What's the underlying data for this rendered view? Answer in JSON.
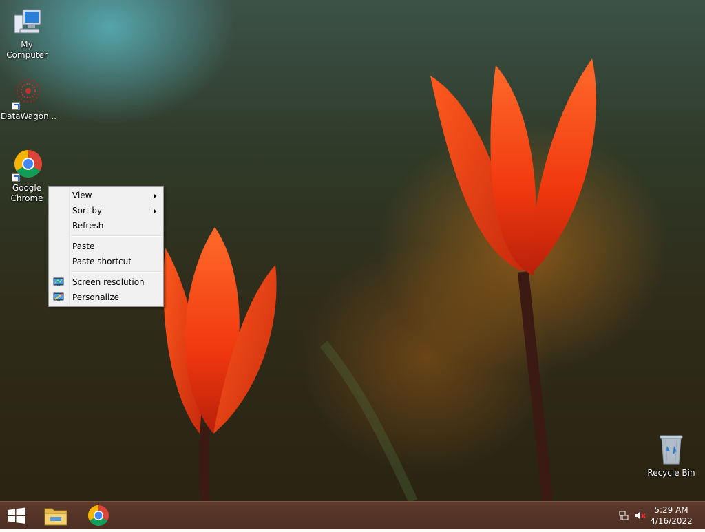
{
  "desktop": {
    "icons": [
      {
        "label": "My Computer"
      },
      {
        "label": "DataWagon..."
      },
      {
        "label": "Google\nChrome"
      },
      {
        "label": "Recycle Bin"
      }
    ]
  },
  "context_menu": {
    "items": [
      {
        "label": "View",
        "submenu": true
      },
      {
        "label": "Sort by",
        "submenu": true
      },
      {
        "label": "Refresh"
      },
      {
        "label": "Paste"
      },
      {
        "label": "Paste shortcut"
      },
      {
        "label": "Screen resolution",
        "icon": "monitor-icon"
      },
      {
        "label": "Personalize",
        "icon": "personalize-icon"
      }
    ]
  },
  "taskbar": {
    "pinned": [
      {
        "icon": "windows-start-icon"
      },
      {
        "icon": "file-explorer-icon"
      },
      {
        "icon": "chrome-icon"
      }
    ],
    "tray": {
      "network_icon": "network-icon",
      "volume_icon": "volume-muted-icon",
      "time": "5:29 AM",
      "date": "4/16/2022"
    }
  },
  "colors": {
    "taskbar": "#4c2e22",
    "menu_bg": "#f0f0f0",
    "tulip": "#ff4a10"
  }
}
